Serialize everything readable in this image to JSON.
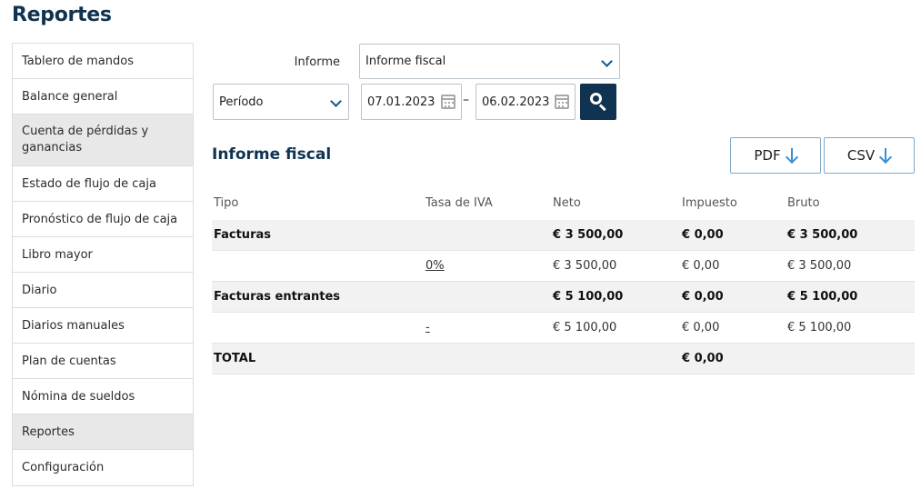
{
  "page": {
    "title": "Reportes"
  },
  "sidebar": {
    "items": [
      {
        "label": "Tablero de mandos"
      },
      {
        "label": "Balance general"
      },
      {
        "label": "Cuenta de pérdidas y ganancias"
      },
      {
        "label": "Estado de flujo de caja"
      },
      {
        "label": "Pronóstico de flujo de caja"
      },
      {
        "label": "Libro mayor"
      },
      {
        "label": "Diario"
      },
      {
        "label": "Diarios manuales"
      },
      {
        "label": "Plan de cuentas"
      },
      {
        "label": "Nómina de sueldos"
      },
      {
        "label": "Reportes"
      },
      {
        "label": "Configuración"
      }
    ]
  },
  "filters": {
    "informe_label": "Informe",
    "informe_value": "Informe fiscal",
    "periodo_value": "Período",
    "date_from": "07.01.2023",
    "date_separator": "–",
    "date_to": "06.02.2023"
  },
  "report": {
    "title": "Informe fiscal",
    "pdf_label": "PDF",
    "csv_label": "CSV",
    "columns": {
      "tipo": "Tipo",
      "tasa": "Tasa de IVA",
      "neto": "Neto",
      "impuesto": "Impuesto",
      "bruto": "Bruto"
    },
    "rows": [
      {
        "tipo": "Facturas",
        "tasa": "",
        "neto": "€ 3 500,00",
        "impuesto": "€ 0,00",
        "bruto": "€ 3 500,00"
      },
      {
        "tipo": "",
        "tasa": "0%",
        "neto": "€ 3 500,00",
        "impuesto": "€ 0,00",
        "bruto": "€ 3 500,00"
      },
      {
        "tipo": "Facturas entrantes",
        "tasa": "",
        "neto": "€ 5 100,00",
        "impuesto": "€ 0,00",
        "bruto": "€ 5 100,00"
      },
      {
        "tipo": "",
        "tasa": "-",
        "neto": "€ 5 100,00",
        "impuesto": "€ 0,00",
        "bruto": "€ 5 100,00"
      },
      {
        "tipo": "TOTAL",
        "tasa": "",
        "neto": "",
        "impuesto": "€ 0,00",
        "bruto": ""
      }
    ]
  }
}
